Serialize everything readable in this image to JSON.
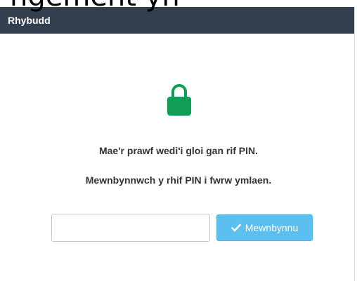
{
  "overlay": {
    "clipped_text": "ngement yn"
  },
  "dialog": {
    "title": "Rhybudd",
    "lock_icon": "lock-icon",
    "message_locked": "Mae'r prawf wedi'i gloi gan rif PIN.",
    "message_enter": "Mewnbynnwch y rhif PIN i fwrw ymlaen.",
    "pin_input": {
      "value": "",
      "placeholder": ""
    },
    "submit_label": "Mewnbynnu",
    "submit_icon": "check-icon"
  },
  "colors": {
    "header_bg": "#333f4f",
    "lock_green": "#0f9d58",
    "button_blue": "#5bc0ef"
  }
}
